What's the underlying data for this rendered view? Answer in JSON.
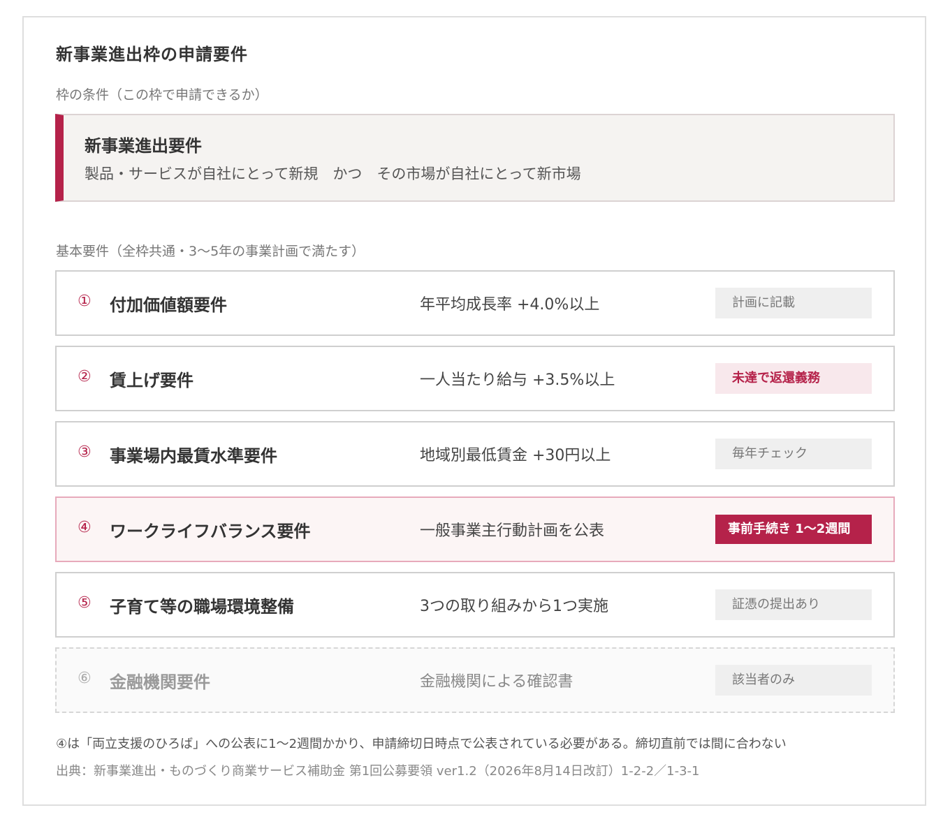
{
  "title": "新事業進出枠の申請要件",
  "condition_section": {
    "label": "枠の条件（この枠で申請できるか）",
    "box_title": "新事業進出要件",
    "box_desc": "製品・サービスが自社にとって新規　かつ　その市場が自社にとって新市場"
  },
  "basic_section": {
    "label": "基本要件（全枠共通・3〜5年の事業計画で満たす）",
    "items": [
      {
        "num": "①",
        "name": "付加価値額要件",
        "condition": "年平均成長率 +4.0%以上",
        "badge": "計画に記載"
      },
      {
        "num": "②",
        "name": "賃上げ要件",
        "condition": "一人当たり給与 +3.5%以上",
        "badge": "未達で返還義務"
      },
      {
        "num": "③",
        "name": "事業場内最賃水準要件",
        "condition": "地域別最低賃金 +30円以上",
        "badge": "毎年チェック"
      },
      {
        "num": "④",
        "name": "ワークライフバランス要件",
        "condition": "一般事業主行動計画を公表",
        "badge": "事前手続き 1〜2週間"
      },
      {
        "num": "⑤",
        "name": "子育て等の職場環境整備",
        "condition": "3つの取り組みから1つ実施",
        "badge": "証憑の提出あり"
      },
      {
        "num": "⑥",
        "name": "金融機関要件",
        "condition": "金融機関による確認書",
        "badge": "該当者のみ"
      }
    ]
  },
  "note": "④は「両立支援のひろば」への公表に1〜2週間かかり、申請締切日時点で公表されている必要がある。締切直前では間に合わない",
  "source": "出典：新事業進出・ものづくり商業サービス補助金 第1回公募要領 ver1.2（2026年8月14日改訂）1-2-2／1-3-1",
  "colors": {
    "accent": "#b5224a",
    "badge_gray": "#efefef",
    "badge_pink": "#f8e8ec",
    "box_bg": "#f5f3f1"
  }
}
